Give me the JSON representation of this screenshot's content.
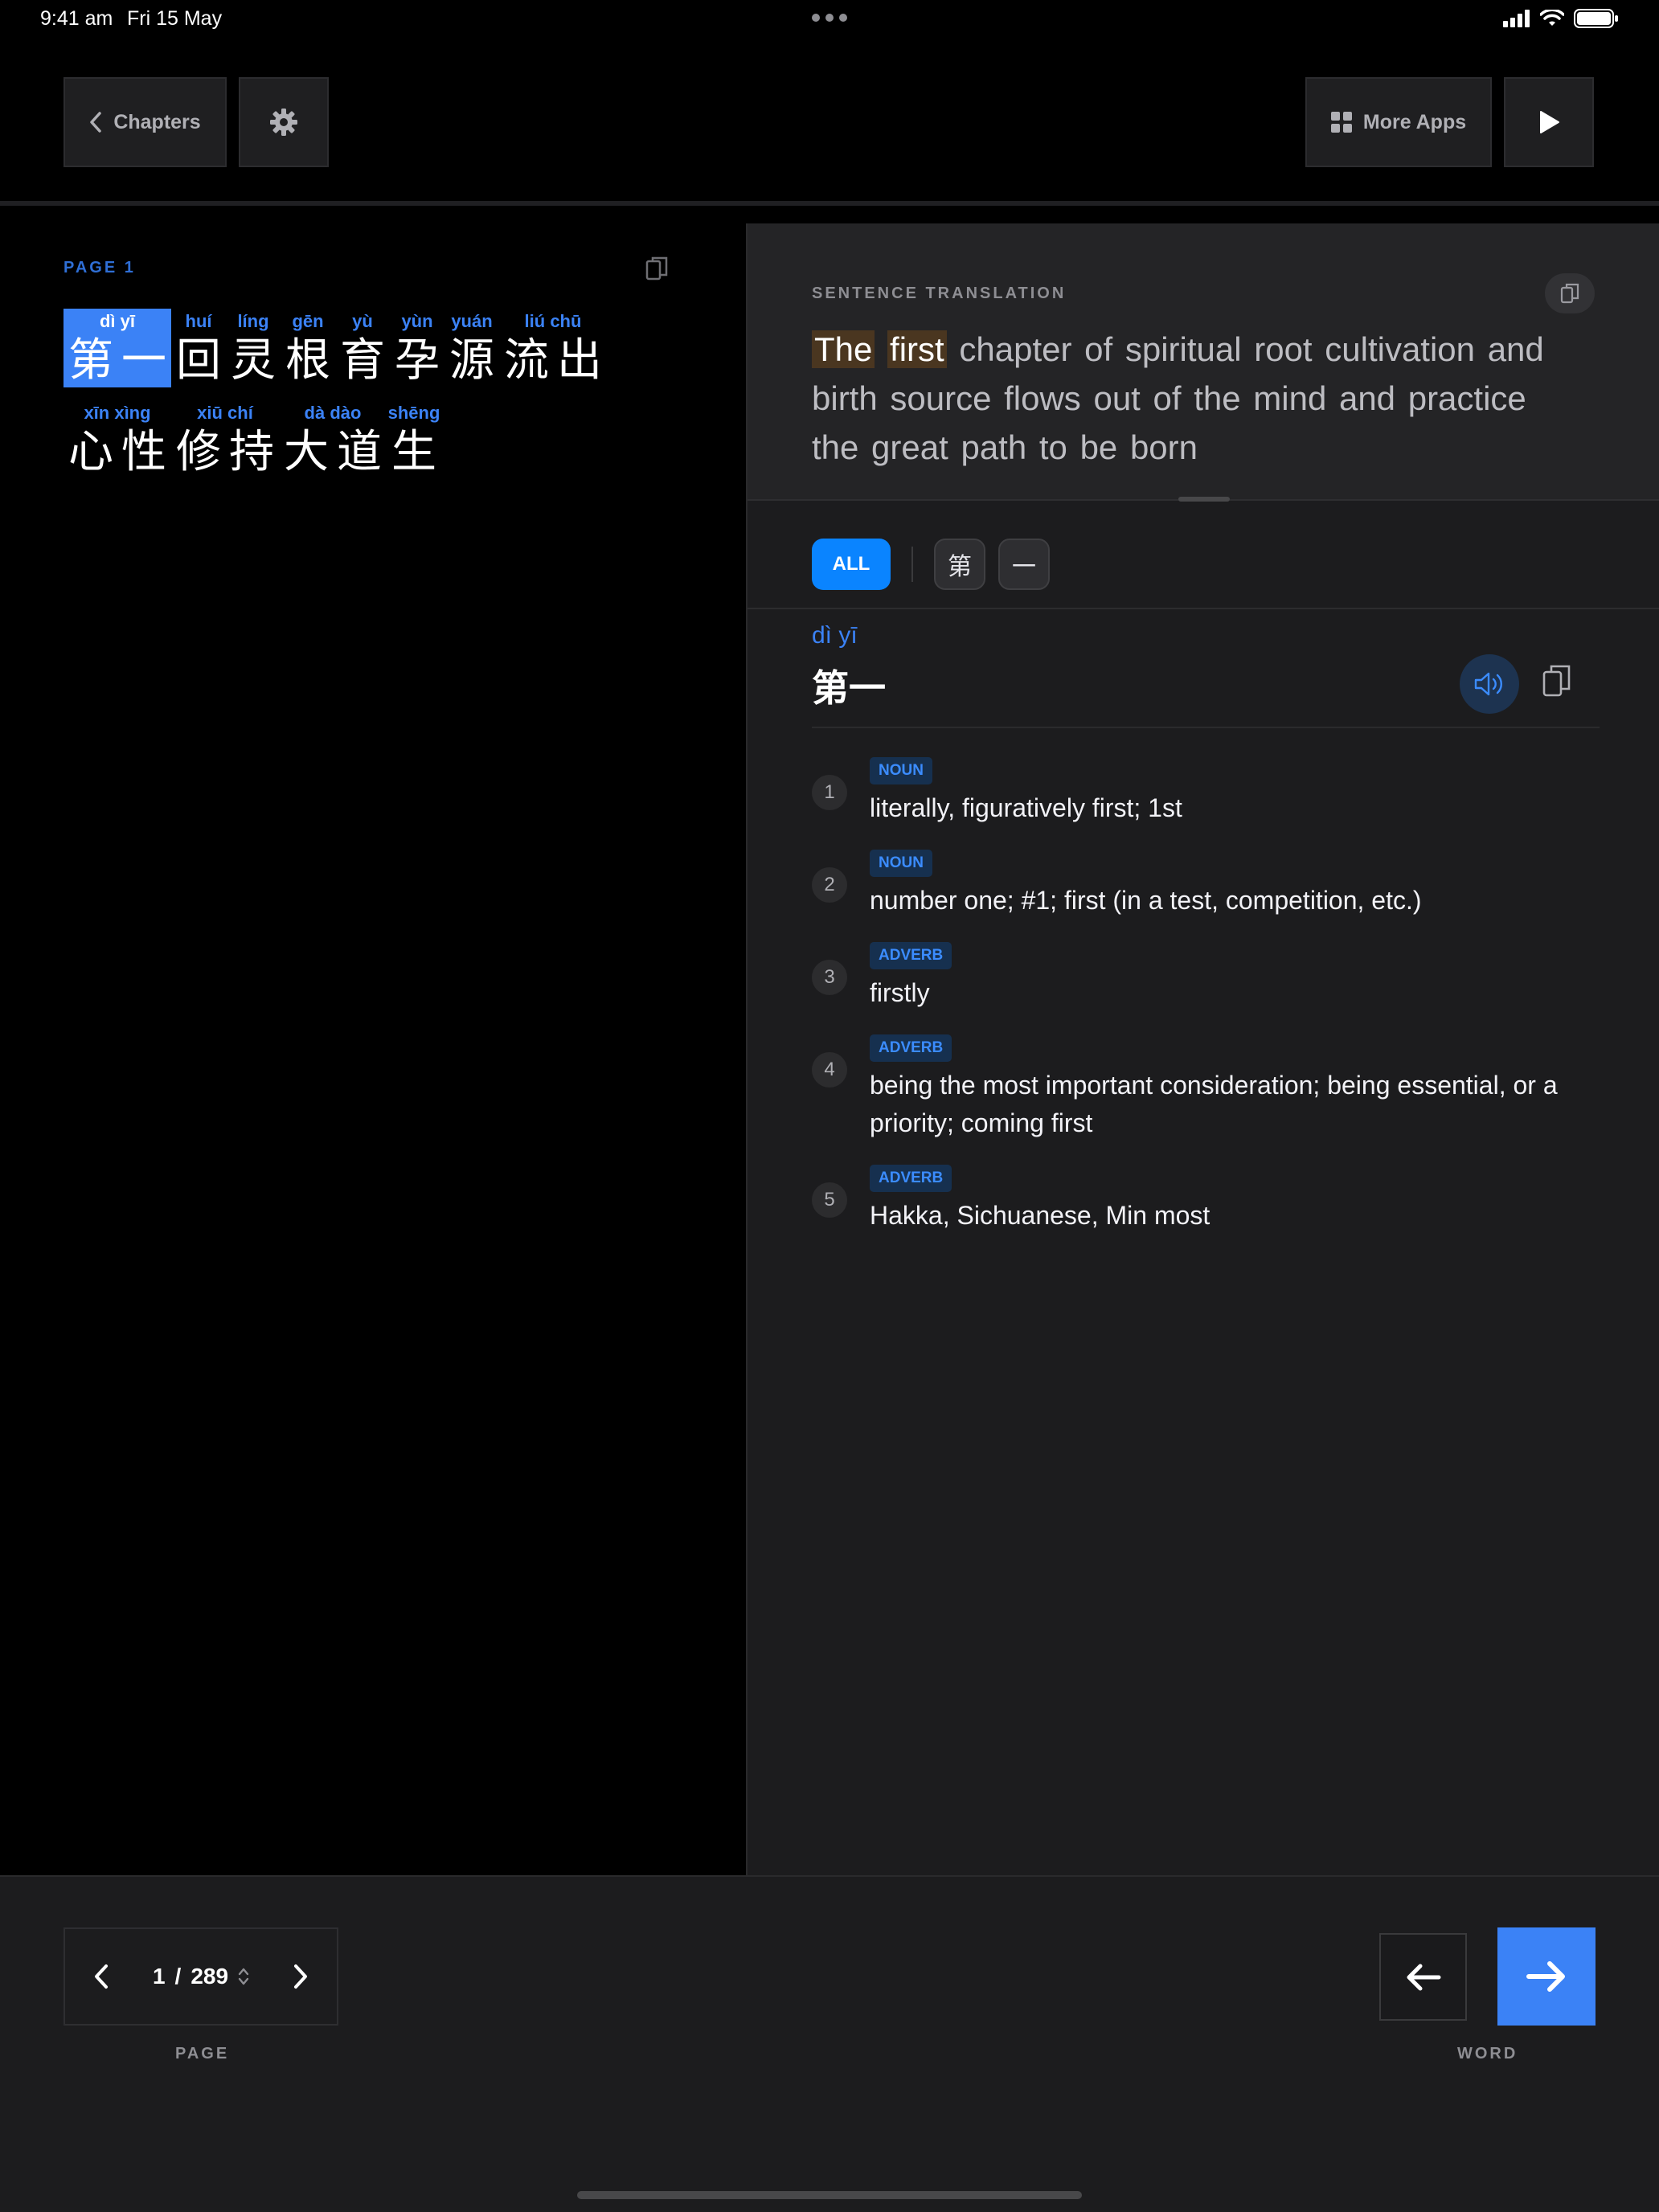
{
  "status_bar": {
    "time": "9:41 am",
    "date": "Fri 15 May"
  },
  "toolbar": {
    "chapters_label": "Chapters",
    "more_apps_label": "More Apps"
  },
  "reader": {
    "page_label": "PAGE  1",
    "lines": [
      [
        {
          "pinyin": "dì yī",
          "chars": [
            "第",
            "一"
          ],
          "selected": true
        },
        {
          "pinyin": "huí",
          "chars": [
            "回"
          ]
        },
        {
          "pinyin": "líng",
          "chars": [
            "灵"
          ]
        },
        {
          "pinyin": "gēn",
          "chars": [
            "根"
          ]
        },
        {
          "pinyin": "yù",
          "chars": [
            "育"
          ]
        },
        {
          "pinyin": "yùn",
          "chars": [
            "孕"
          ]
        },
        {
          "pinyin": "yuán",
          "chars": [
            "源"
          ]
        },
        {
          "pinyin": "liú chū",
          "chars": [
            "流",
            "出"
          ]
        }
      ],
      [
        {
          "pinyin": "xīn xìng",
          "chars": [
            "心",
            "性"
          ]
        },
        {
          "pinyin": "xiū chí",
          "chars": [
            "修",
            "持"
          ]
        },
        {
          "pinyin": "dà dào",
          "chars": [
            "大",
            "道"
          ]
        },
        {
          "pinyin": "shēng",
          "chars": [
            "生"
          ]
        }
      ]
    ]
  },
  "translation": {
    "label": "SENTENCE TRANSLATION",
    "highlight_1": "The",
    "highlight_2": "first",
    "rest": "chapter of spiritual root cultivation and birth source flows out of the mind and practice the great path to be born"
  },
  "filters": {
    "all_label": "ALL",
    "chars": [
      "第",
      "一"
    ]
  },
  "entry": {
    "pinyin": "dì yī",
    "hanzi": "第一",
    "definitions": [
      {
        "num": "1",
        "pos": "NOUN",
        "text": "literally, figuratively first; 1st"
      },
      {
        "num": "2",
        "pos": "NOUN",
        "text": "number one; #1; first (in a test, competition, etc.)"
      },
      {
        "num": "3",
        "pos": "ADVERB",
        "text": "firstly"
      },
      {
        "num": "4",
        "pos": "ADVERB",
        "text": "being the most important consideration; being essential, or a priority; coming first"
      },
      {
        "num": "5",
        "pos": "ADVERB",
        "text": "Hakka, Sichuanese, Min most"
      }
    ]
  },
  "pager": {
    "current": "1",
    "separator": "/",
    "total": "289",
    "label": "PAGE"
  },
  "word_nav": {
    "label": "WORD"
  },
  "colors": {
    "accent": "#3b82f6",
    "highlight": "#4a3620",
    "panel": "#1c1c1e"
  }
}
